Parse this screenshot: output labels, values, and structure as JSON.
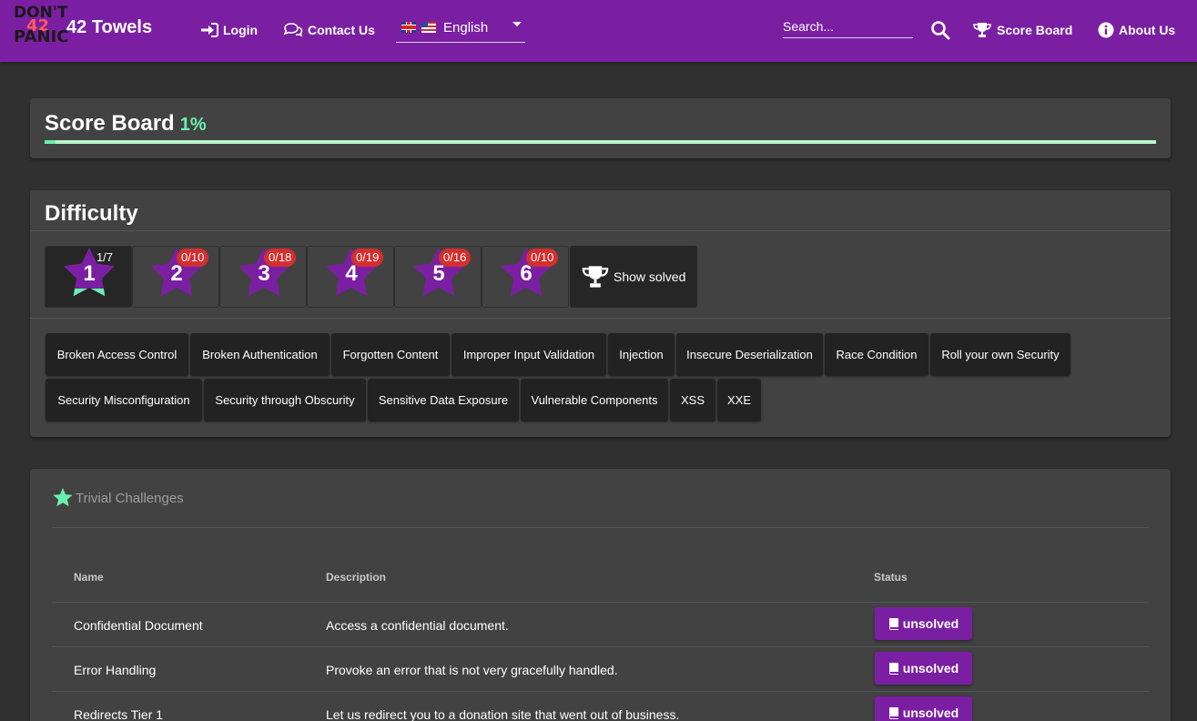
{
  "header": {
    "logo_top": "DON'T",
    "logo_number": "42",
    "logo_bottom": "PANIC",
    "app_title": "42 Towels",
    "login_label": "Login",
    "contact_label": "Contact Us",
    "language": "English",
    "search_placeholder": "Search...",
    "score_board_label": "Score Board",
    "about_label": "About Us"
  },
  "score": {
    "title": "Score Board",
    "percent": "1%",
    "progress_fraction": 0.01
  },
  "difficulty": {
    "title": "Difficulty",
    "levels": [
      {
        "num": "1",
        "badge": "1/7"
      },
      {
        "num": "2",
        "badge": "0/10"
      },
      {
        "num": "3",
        "badge": "0/18"
      },
      {
        "num": "4",
        "badge": "0/19"
      },
      {
        "num": "5",
        "badge": "0/16"
      },
      {
        "num": "6",
        "badge": "0/10"
      }
    ],
    "show_solved_label": "Show solved"
  },
  "categories": [
    "Broken Access Control",
    "Broken Authentication",
    "Forgotten Content",
    "Improper Input Validation",
    "Injection",
    "Insecure Deserialization",
    "Race Condition",
    "Roll your own Security",
    "Security Misconfiguration",
    "Security through Obscurity",
    "Sensitive Data Exposure",
    "Vulnerable Components",
    "XSS",
    "XXE"
  ],
  "challenges": {
    "heading": "Trivial Challenges",
    "columns": {
      "name": "Name",
      "description": "Description",
      "status": "Status"
    },
    "rows": [
      {
        "name": "Confidential Document",
        "description": "Access a confidential document.",
        "status": "unsolved"
      },
      {
        "name": "Error Handling",
        "description": "Provoke an error that is not very gracefully handled.",
        "status": "unsolved"
      },
      {
        "name": "Redirects Tier 1",
        "description": "Let us redirect you to a donation site that went out of business.",
        "status": "unsolved"
      }
    ]
  },
  "colors": {
    "toolbar": "#7b1fa2",
    "accent_green": "#69f0ae",
    "badge_red": "#d32f2f",
    "card": "#424242",
    "background": "#303030"
  }
}
